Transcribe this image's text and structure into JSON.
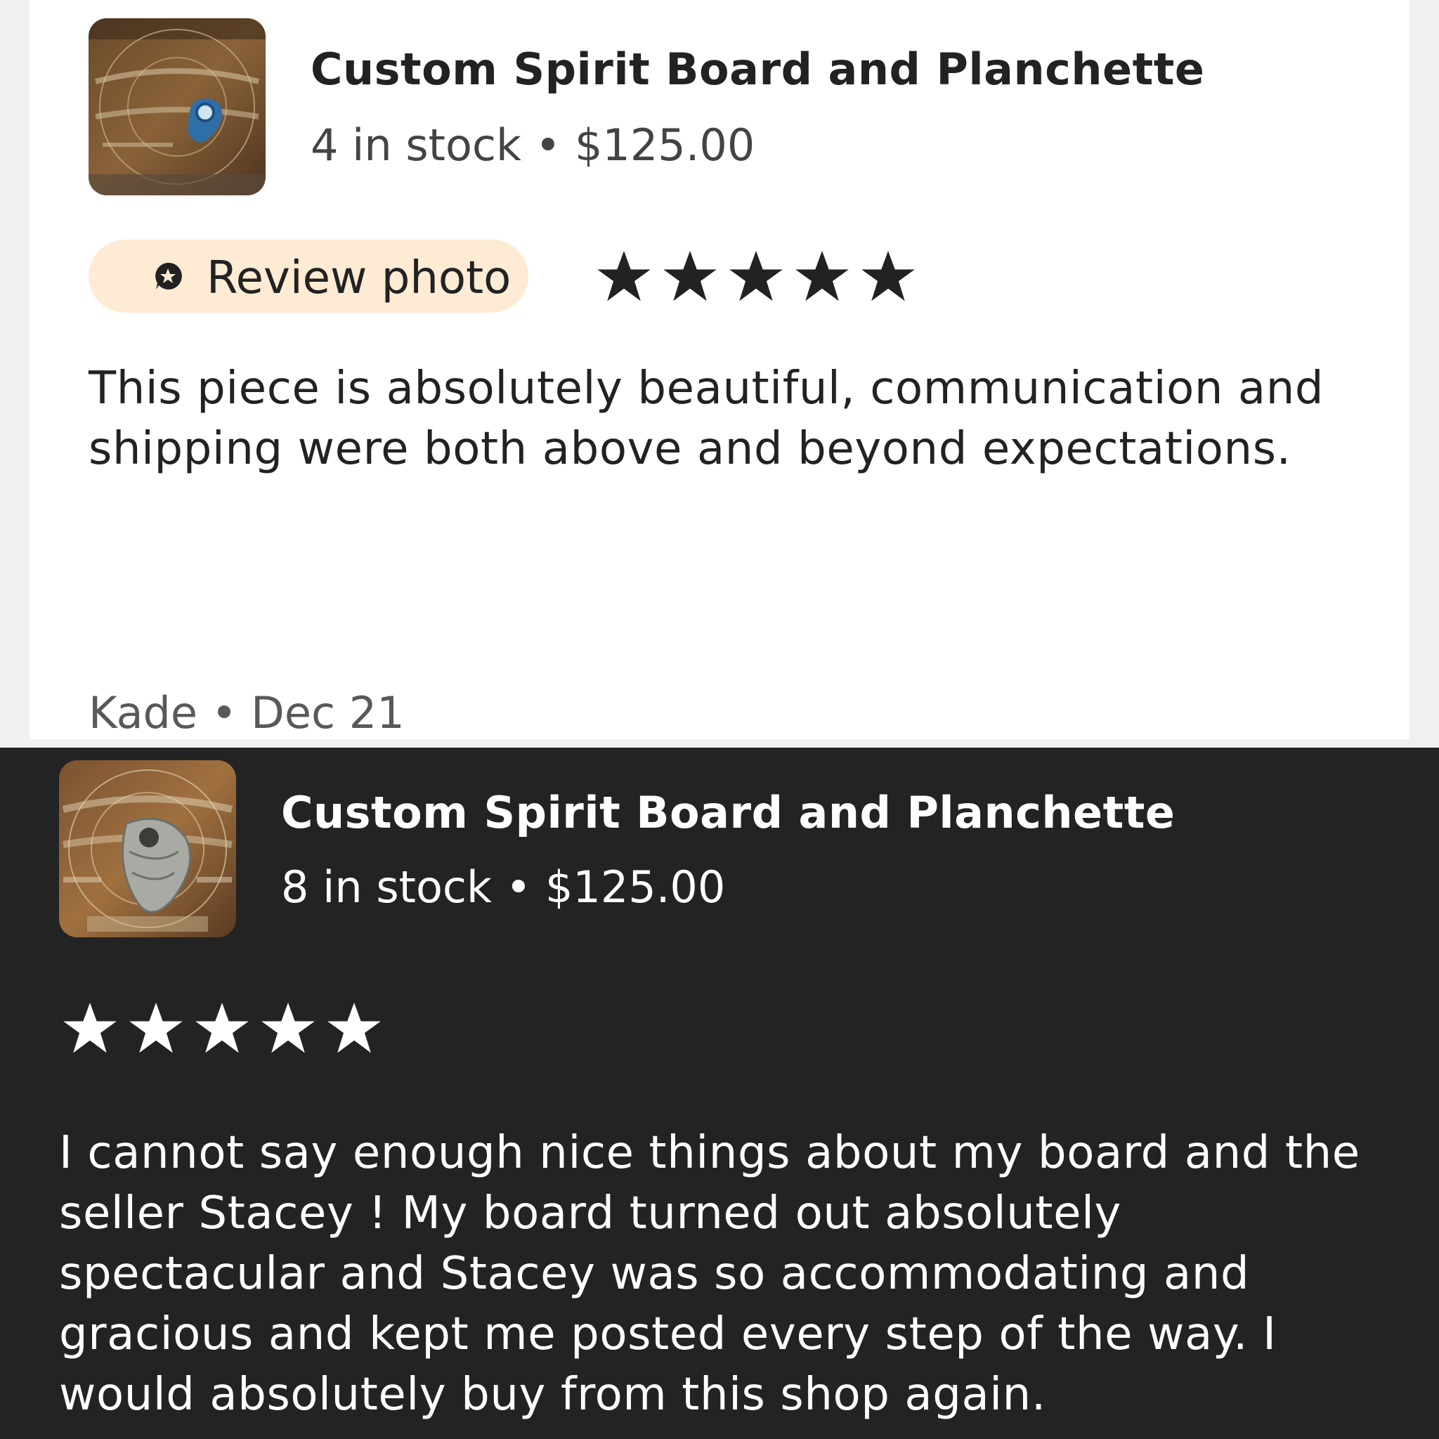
{
  "reviews": [
    {
      "product_title": "Custom Spirit Board and Planchette",
      "stock": "4 in stock",
      "separator": "•",
      "price": "$125.00",
      "review_photo_label": "Review photo",
      "rating": 5,
      "body_lines": [
        "This piece is absolutely beautiful, communication and",
        "shipping were both above and beyond expectations."
      ],
      "reviewer": "Kade",
      "date": "Dec 21",
      "theme": "light"
    },
    {
      "product_title": "Custom Spirit Board and Planchette",
      "stock": "8 in stock",
      "separator": "•",
      "price": "$125.00",
      "rating": 5,
      "body_lines": [
        "I cannot say enough nice things about my board and the",
        "seller Stacey ! My board turned out absolutely",
        "spectacular and Stacey was so accommodating and",
        "gracious and kept me posted every step of the way. I",
        "would absolutely buy from this shop again."
      ],
      "theme": "dark"
    }
  ],
  "icons": {
    "review_photo": "star-badge-icon",
    "rating_star": "star-icon"
  },
  "colors": {
    "light_card_bg": "#ffffff",
    "dark_card_bg": "#232323",
    "chip_bg": "#fdebd3",
    "star_light": "#222222",
    "star_dark": "#ffffff"
  }
}
